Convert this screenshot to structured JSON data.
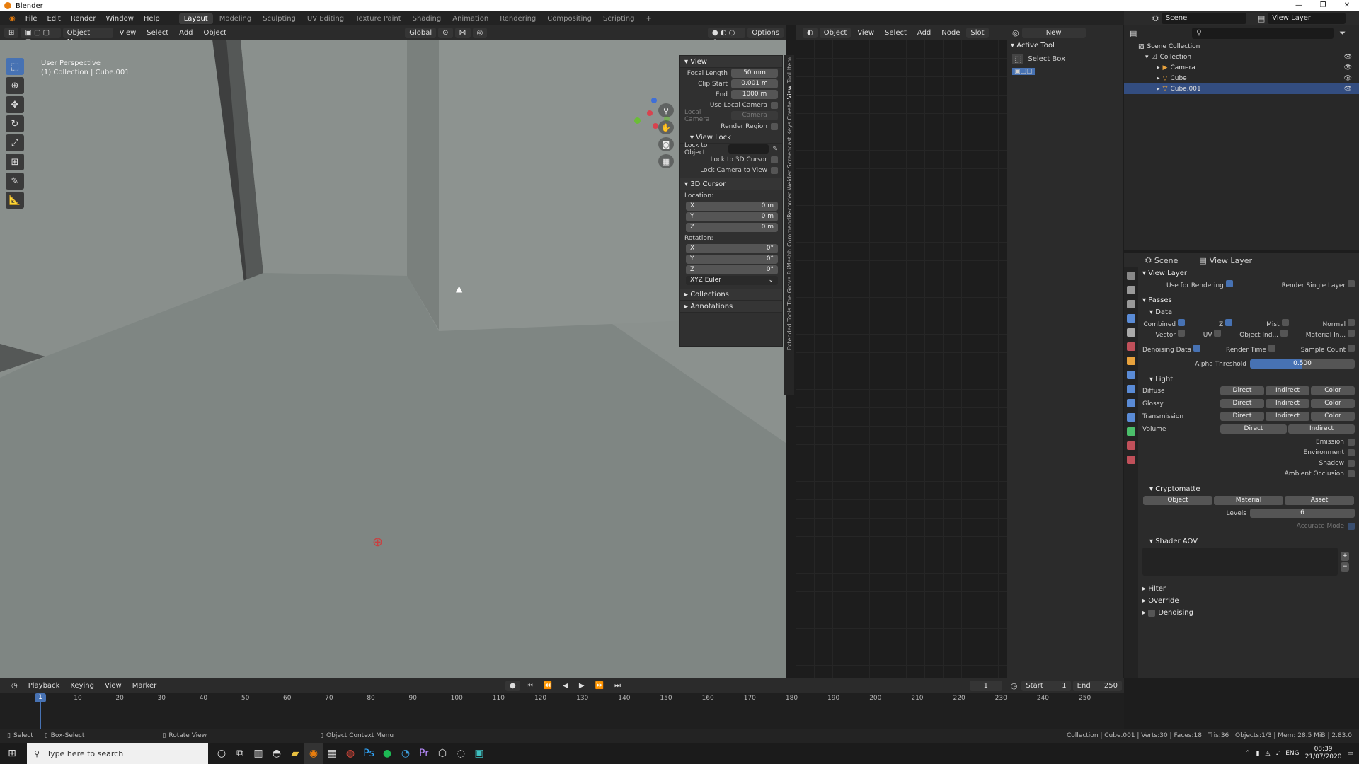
{
  "window": {
    "title": "Blender",
    "controls": [
      "—",
      "❐",
      "✕"
    ]
  },
  "menu": [
    "File",
    "Edit",
    "Render",
    "Window",
    "Help"
  ],
  "workspaces": [
    {
      "label": "Layout",
      "active": true
    },
    {
      "label": "Modeling"
    },
    {
      "label": "Sculpting"
    },
    {
      "label": "UV Editing"
    },
    {
      "label": "Texture Paint"
    },
    {
      "label": "Shading"
    },
    {
      "label": "Animation"
    },
    {
      "label": "Rendering"
    },
    {
      "label": "Compositing"
    },
    {
      "label": "Scripting"
    },
    {
      "label": "+"
    }
  ],
  "topright": {
    "scene": "Scene",
    "view_layer": "View Layer"
  },
  "viewport_header": {
    "mode": "Object Mode",
    "items": [
      "View",
      "Select",
      "Add",
      "Object"
    ],
    "orientation": "Global",
    "options": "Options"
  },
  "viewport": {
    "perspective": "User Perspective",
    "collection": "(1) Collection | Cube.001"
  },
  "npanel": {
    "view_title": "View",
    "focal_length_label": "Focal Length",
    "focal_length": "50 mm",
    "clip_start_label": "Clip Start",
    "clip_start": "0.001 m",
    "end_label": "End",
    "end": "1000 m",
    "use_local_camera": "Use Local Camera",
    "local_camera_label": "Local Camera",
    "local_camera": "Camera",
    "render_region": "Render Region",
    "view_lock_title": "View Lock",
    "lock_to_object": "Lock to Object",
    "lock_to_3d_cursor": "Lock to 3D Cursor",
    "lock_camera_to_view": "Lock Camera to View",
    "cursor_title": "3D Cursor",
    "location_label": "Location:",
    "loc": [
      {
        "axis": "X",
        "val": "0 m"
      },
      {
        "axis": "Y",
        "val": "0 m"
      },
      {
        "axis": "Z",
        "val": "0 m"
      }
    ],
    "rotation_label": "Rotation:",
    "rot": [
      {
        "axis": "X",
        "val": "0°"
      },
      {
        "axis": "Y",
        "val": "0°"
      },
      {
        "axis": "Z",
        "val": "0°"
      }
    ],
    "rotation_mode": "XYZ Euler",
    "collections": "Collections",
    "annotations": "Annotations"
  },
  "sidetabs": [
    "Item",
    "Tool",
    "View",
    "Create",
    "Screencast Keys",
    "Weider",
    "CommandRecorder",
    "iMeshh",
    "The Grove 8",
    "Extended Tools"
  ],
  "node_editor": {
    "object": "Object",
    "items": [
      "View",
      "Select",
      "Add",
      "Node"
    ],
    "slot": "Slot",
    "new": "New"
  },
  "active_tool": {
    "title": "Active Tool",
    "tool": "Select Box"
  },
  "outliner": {
    "rows": [
      {
        "label": "Scene Collection",
        "indent": 0
      },
      {
        "label": "Collection",
        "indent": 1
      },
      {
        "label": "Camera",
        "indent": 2
      },
      {
        "label": "Cube",
        "indent": 2
      },
      {
        "label": "Cube.001",
        "indent": 2,
        "selected": true
      }
    ]
  },
  "properties": {
    "scene": "Scene",
    "view_layer": "View Layer",
    "section_view_layer": "View Layer",
    "use_for_rendering": "Use for Rendering",
    "render_single_layer": "Render Single Layer",
    "passes": "Passes",
    "data": "Data",
    "combined": "Combined",
    "z": "Z",
    "mist": "Mist",
    "normal": "Normal",
    "vector": "Vector",
    "uv": "UV",
    "object_index": "Object Ind...",
    "material_index": "Material In...",
    "denoising_data": "Denoising Data",
    "render_time": "Render Time",
    "sample_count": "Sample Count",
    "alpha_threshold_label": "Alpha Threshold",
    "alpha_threshold": "0.500",
    "alpha_threshold_value": 0.5,
    "light": "Light",
    "light_rows": [
      {
        "label": "Diffuse",
        "btns": [
          "Direct",
          "Indirect",
          "Color"
        ]
      },
      {
        "label": "Glossy",
        "btns": [
          "Direct",
          "Indirect",
          "Color"
        ]
      },
      {
        "label": "Transmission",
        "btns": [
          "Direct",
          "Indirect",
          "Color"
        ]
      },
      {
        "label": "Volume",
        "btns": [
          "Direct",
          "Indirect"
        ]
      }
    ],
    "emission": "Emission",
    "environment": "Environment",
    "shadow": "Shadow",
    "ambient_occlusion": "Ambient Occlusion",
    "cryptomatte": "Cryptomatte",
    "crypto_btns": [
      "Object",
      "Material",
      "Asset"
    ],
    "levels_label": "Levels",
    "levels": "6",
    "accurate_mode": "Accurate Mode",
    "shader_aov": "Shader AOV",
    "filter": "Filter",
    "override": "Override",
    "denoising": "Denoising"
  },
  "timeline": {
    "menus": [
      "Playback",
      "Keying",
      "View",
      "Marker"
    ],
    "current_frame": "1",
    "start_label": "Start",
    "start": "1",
    "end_label": "End",
    "end": "250",
    "ticks": [
      "10",
      "20",
      "30",
      "40",
      "50",
      "60",
      "70",
      "80",
      "90",
      "100",
      "110",
      "120",
      "130",
      "140",
      "150",
      "160",
      "170",
      "180",
      "190",
      "200",
      "210",
      "220",
      "230",
      "240",
      "250"
    ]
  },
  "status": {
    "select": "Select",
    "box_select": "Box-Select",
    "rotate_view": "Rotate View",
    "context_menu": "Object Context Menu",
    "stats": "Collection | Cube.001 | Verts:30 | Faces:18 | Tris:36 | Objects:1/3 | Mem: 28.5 MiB | 2.83.0"
  },
  "taskbar": {
    "search_placeholder": "Type here to search",
    "lang": "ENG",
    "time": "08:39",
    "date": "21/07/2020"
  }
}
